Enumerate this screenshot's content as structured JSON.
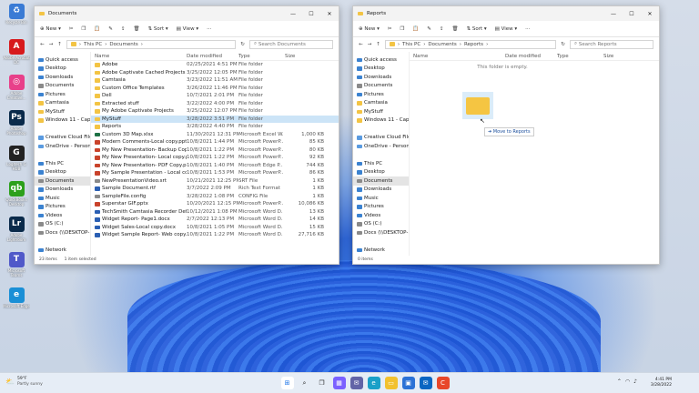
{
  "desktop": [
    {
      "label": "Recycle Bin",
      "bg": "#3a7bd5",
      "g": "♻"
    },
    {
      "label": "Adobe Acrobat DC",
      "bg": "#d7191c",
      "g": "A"
    },
    {
      "label": "Adobe Creative...",
      "bg": "#e8408a",
      "g": "◎"
    },
    {
      "label": "Adobe Photoshop",
      "bg": "#0a2a4a",
      "g": "Ps"
    },
    {
      "label": "Logitech G HUB",
      "bg": "#222",
      "g": "G"
    },
    {
      "label": "QuickBooks Desktop",
      "bg": "#2ca01c",
      "g": "qb"
    },
    {
      "label": "Adobe Lightroom",
      "bg": "#0a2a4a",
      "g": "Lr"
    },
    {
      "label": "Microsoft Teams",
      "bg": "#5059c9",
      "g": "T"
    },
    {
      "label": "Microsoft Edge",
      "bg": "#1a8fd6",
      "g": "e"
    }
  ],
  "left": {
    "title": "Documents",
    "toolbar": {
      "new": "New",
      "sort": "Sort",
      "view": "View"
    },
    "path": [
      "This PC",
      "Documents"
    ],
    "search": "Search Documents",
    "cols": [
      "Name",
      "Date modified",
      "Type",
      "Size"
    ],
    "nav": [
      {
        "l": "Quick access",
        "c": "blue"
      },
      {
        "l": "Desktop",
        "c": "blue"
      },
      {
        "l": "Downloads",
        "c": "blue"
      },
      {
        "l": "Documents",
        "c": "gray"
      },
      {
        "l": "Pictures",
        "c": "blue"
      },
      {
        "l": "Camtasia",
        "c": ""
      },
      {
        "l": "MyStuff",
        "c": ""
      },
      {
        "l": "Windows 11 - Capts",
        "c": ""
      },
      {
        "l": "",
        "c": "none"
      },
      {
        "l": "Creative Cloud Files",
        "c": "cloud"
      },
      {
        "l": "OneDrive - Personal",
        "c": "cloud"
      },
      {
        "l": "",
        "c": "none"
      },
      {
        "l": "This PC",
        "c": "blue"
      },
      {
        "l": "Desktop",
        "c": "blue"
      },
      {
        "l": "Documents",
        "c": "gray",
        "sel": true
      },
      {
        "l": "Downloads",
        "c": "blue"
      },
      {
        "l": "Music",
        "c": "blue"
      },
      {
        "l": "Pictures",
        "c": "blue"
      },
      {
        "l": "Videos",
        "c": "blue"
      },
      {
        "l": "OS (C:)",
        "c": "gray"
      },
      {
        "l": "Docs (\\\\DESKTOP-...",
        "c": "gray"
      },
      {
        "l": "",
        "c": "none"
      },
      {
        "l": "Network",
        "c": "blue"
      }
    ],
    "files": [
      {
        "n": "Adobe",
        "d": "02/25/2021 4:51 PM",
        "t": "File folder",
        "s": "",
        "f": "fld"
      },
      {
        "n": "Adobe Captivate Cached Projects",
        "d": "3/25/2022 12:05 PM",
        "t": "File folder",
        "s": "",
        "f": "fld"
      },
      {
        "n": "Camtasia",
        "d": "3/23/2022 11:51 AM",
        "t": "File folder",
        "s": "",
        "f": "fld"
      },
      {
        "n": "Custom Office Templates",
        "d": "3/26/2022 11:46 PM",
        "t": "File folder",
        "s": "",
        "f": "fld"
      },
      {
        "n": "Dell",
        "d": "10/7/2021 2:01 PM",
        "t": "File folder",
        "s": "",
        "f": "fld"
      },
      {
        "n": "Extracted stuff",
        "d": "3/22/2022 4:00 PM",
        "t": "File folder",
        "s": "",
        "f": "fld"
      },
      {
        "n": "My Adobe Captivate Projects",
        "d": "3/25/2022 12:07 PM",
        "t": "File folder",
        "s": "",
        "f": "fld"
      },
      {
        "n": "MyStuff",
        "d": "3/28/2022 3:51 PM",
        "t": "File folder",
        "s": "",
        "f": "fld",
        "sel": true
      },
      {
        "n": "Reports",
        "d": "3/28/2022 4:40 PM",
        "t": "File folder",
        "s": "",
        "f": "fld"
      },
      {
        "n": "Custom 3D Map.xlsx",
        "d": "11/30/2021 12:31 PM",
        "t": "Microsoft Excel W...",
        "s": "1,000 KB",
        "f": "green"
      },
      {
        "n": "Modern Comments-Local copy.pptx",
        "d": "10/8/2021 1:44 PM",
        "t": "Microsoft PowerP...",
        "s": "85 KB",
        "f": "red"
      },
      {
        "n": "My New Presentation- Backup Copy.pptx",
        "d": "10/8/2021 1:22 PM",
        "t": "Microsoft PowerP...",
        "s": "80 KB",
        "f": "red"
      },
      {
        "n": "My New Presentation- Local copy.pptx",
        "d": "10/8/2021 1:22 PM",
        "t": "Microsoft PowerP...",
        "s": "92 KB",
        "f": "red"
      },
      {
        "n": "My New Presentation- PDF Copy.pdf",
        "d": "10/8/2021 1:40 PM",
        "t": "Microsoft Edge P...",
        "s": "744 KB",
        "f": "red"
      },
      {
        "n": "My Sample Presentation - Local copy.pptx",
        "d": "10/8/2021 1:53 PM",
        "t": "Microsoft PowerP...",
        "s": "86 KB",
        "f": "red"
      },
      {
        "n": "NewPresentationVideo.srt",
        "d": "10/21/2021 12:25 PM",
        "t": "SRT File",
        "s": "1 KB",
        "f": "gray"
      },
      {
        "n": "Sample Document.rtf",
        "d": "3/7/2022 2:09 PM",
        "t": "Rich Text Format",
        "s": "1 KB",
        "f": "blue"
      },
      {
        "n": "SampleFile.config",
        "d": "3/28/2022 1:08 PM",
        "t": "CONFIG File",
        "s": "1 KB",
        "f": "gray"
      },
      {
        "n": "Superstar GIF.pptx",
        "d": "10/20/2021 12:15 PM",
        "t": "Microsoft PowerP...",
        "s": "10,086 KB",
        "f": "red"
      },
      {
        "n": "TechSmith Camtasia Recorder Default Di...",
        "d": "10/12/2021 1:08 PM",
        "t": "Microsoft Word D...",
        "s": "13 KB",
        "f": "blue"
      },
      {
        "n": "Widget Report- Page1.docx",
        "d": "2/7/2022 12:13 PM",
        "t": "Microsoft Word D...",
        "s": "14 KB",
        "f": "blue"
      },
      {
        "n": "Widget Sales-Local copy.docx",
        "d": "10/8/2021 1:05 PM",
        "t": "Microsoft Word D...",
        "s": "15 KB",
        "f": "blue"
      },
      {
        "n": "Widget Sample Report- Web copy.docx",
        "d": "10/8/2021 1:22 PM",
        "t": "Microsoft Word D...",
        "s": "27,716 KB",
        "f": "blue"
      }
    ],
    "status": [
      "23 items",
      "1 item selected"
    ]
  },
  "right": {
    "title": "Reports",
    "toolbar": {
      "new": "New",
      "sort": "Sort",
      "view": "View"
    },
    "path": [
      "This PC",
      "Documents",
      "Reports"
    ],
    "search": "Search Reports",
    "cols": [
      "Name",
      "Date modified",
      "Type",
      "Size"
    ],
    "empty": "This folder is empty.",
    "drag_label": "Move to Reports",
    "nav": [
      {
        "l": "Quick access",
        "c": "blue"
      },
      {
        "l": "Desktop",
        "c": "blue"
      },
      {
        "l": "Downloads",
        "c": "blue"
      },
      {
        "l": "Documents",
        "c": "gray"
      },
      {
        "l": "Pictures",
        "c": "blue"
      },
      {
        "l": "Camtasia",
        "c": ""
      },
      {
        "l": "MyStuff",
        "c": ""
      },
      {
        "l": "Windows 11 - Capts",
        "c": ""
      },
      {
        "l": "",
        "c": "none"
      },
      {
        "l": "Creative Cloud Files",
        "c": "cloud"
      },
      {
        "l": "OneDrive - Personal",
        "c": "cloud"
      },
      {
        "l": "",
        "c": "none"
      },
      {
        "l": "This PC",
        "c": "blue"
      },
      {
        "l": "Desktop",
        "c": "blue"
      },
      {
        "l": "Documents",
        "c": "gray",
        "sel": true
      },
      {
        "l": "Downloads",
        "c": "blue"
      },
      {
        "l": "Music",
        "c": "blue"
      },
      {
        "l": "Pictures",
        "c": "blue"
      },
      {
        "l": "Videos",
        "c": "blue"
      },
      {
        "l": "OS (C:)",
        "c": "gray"
      },
      {
        "l": "Docs (\\\\DESKTOP-...",
        "c": "gray"
      },
      {
        "l": "",
        "c": "none"
      },
      {
        "l": "Network",
        "c": "blue"
      }
    ],
    "status": [
      "0 items"
    ]
  },
  "taskbar": {
    "weather_temp": "59°F",
    "weather_desc": "Partly sunny",
    "time": "4:41 PM",
    "date": "3/28/2022"
  }
}
